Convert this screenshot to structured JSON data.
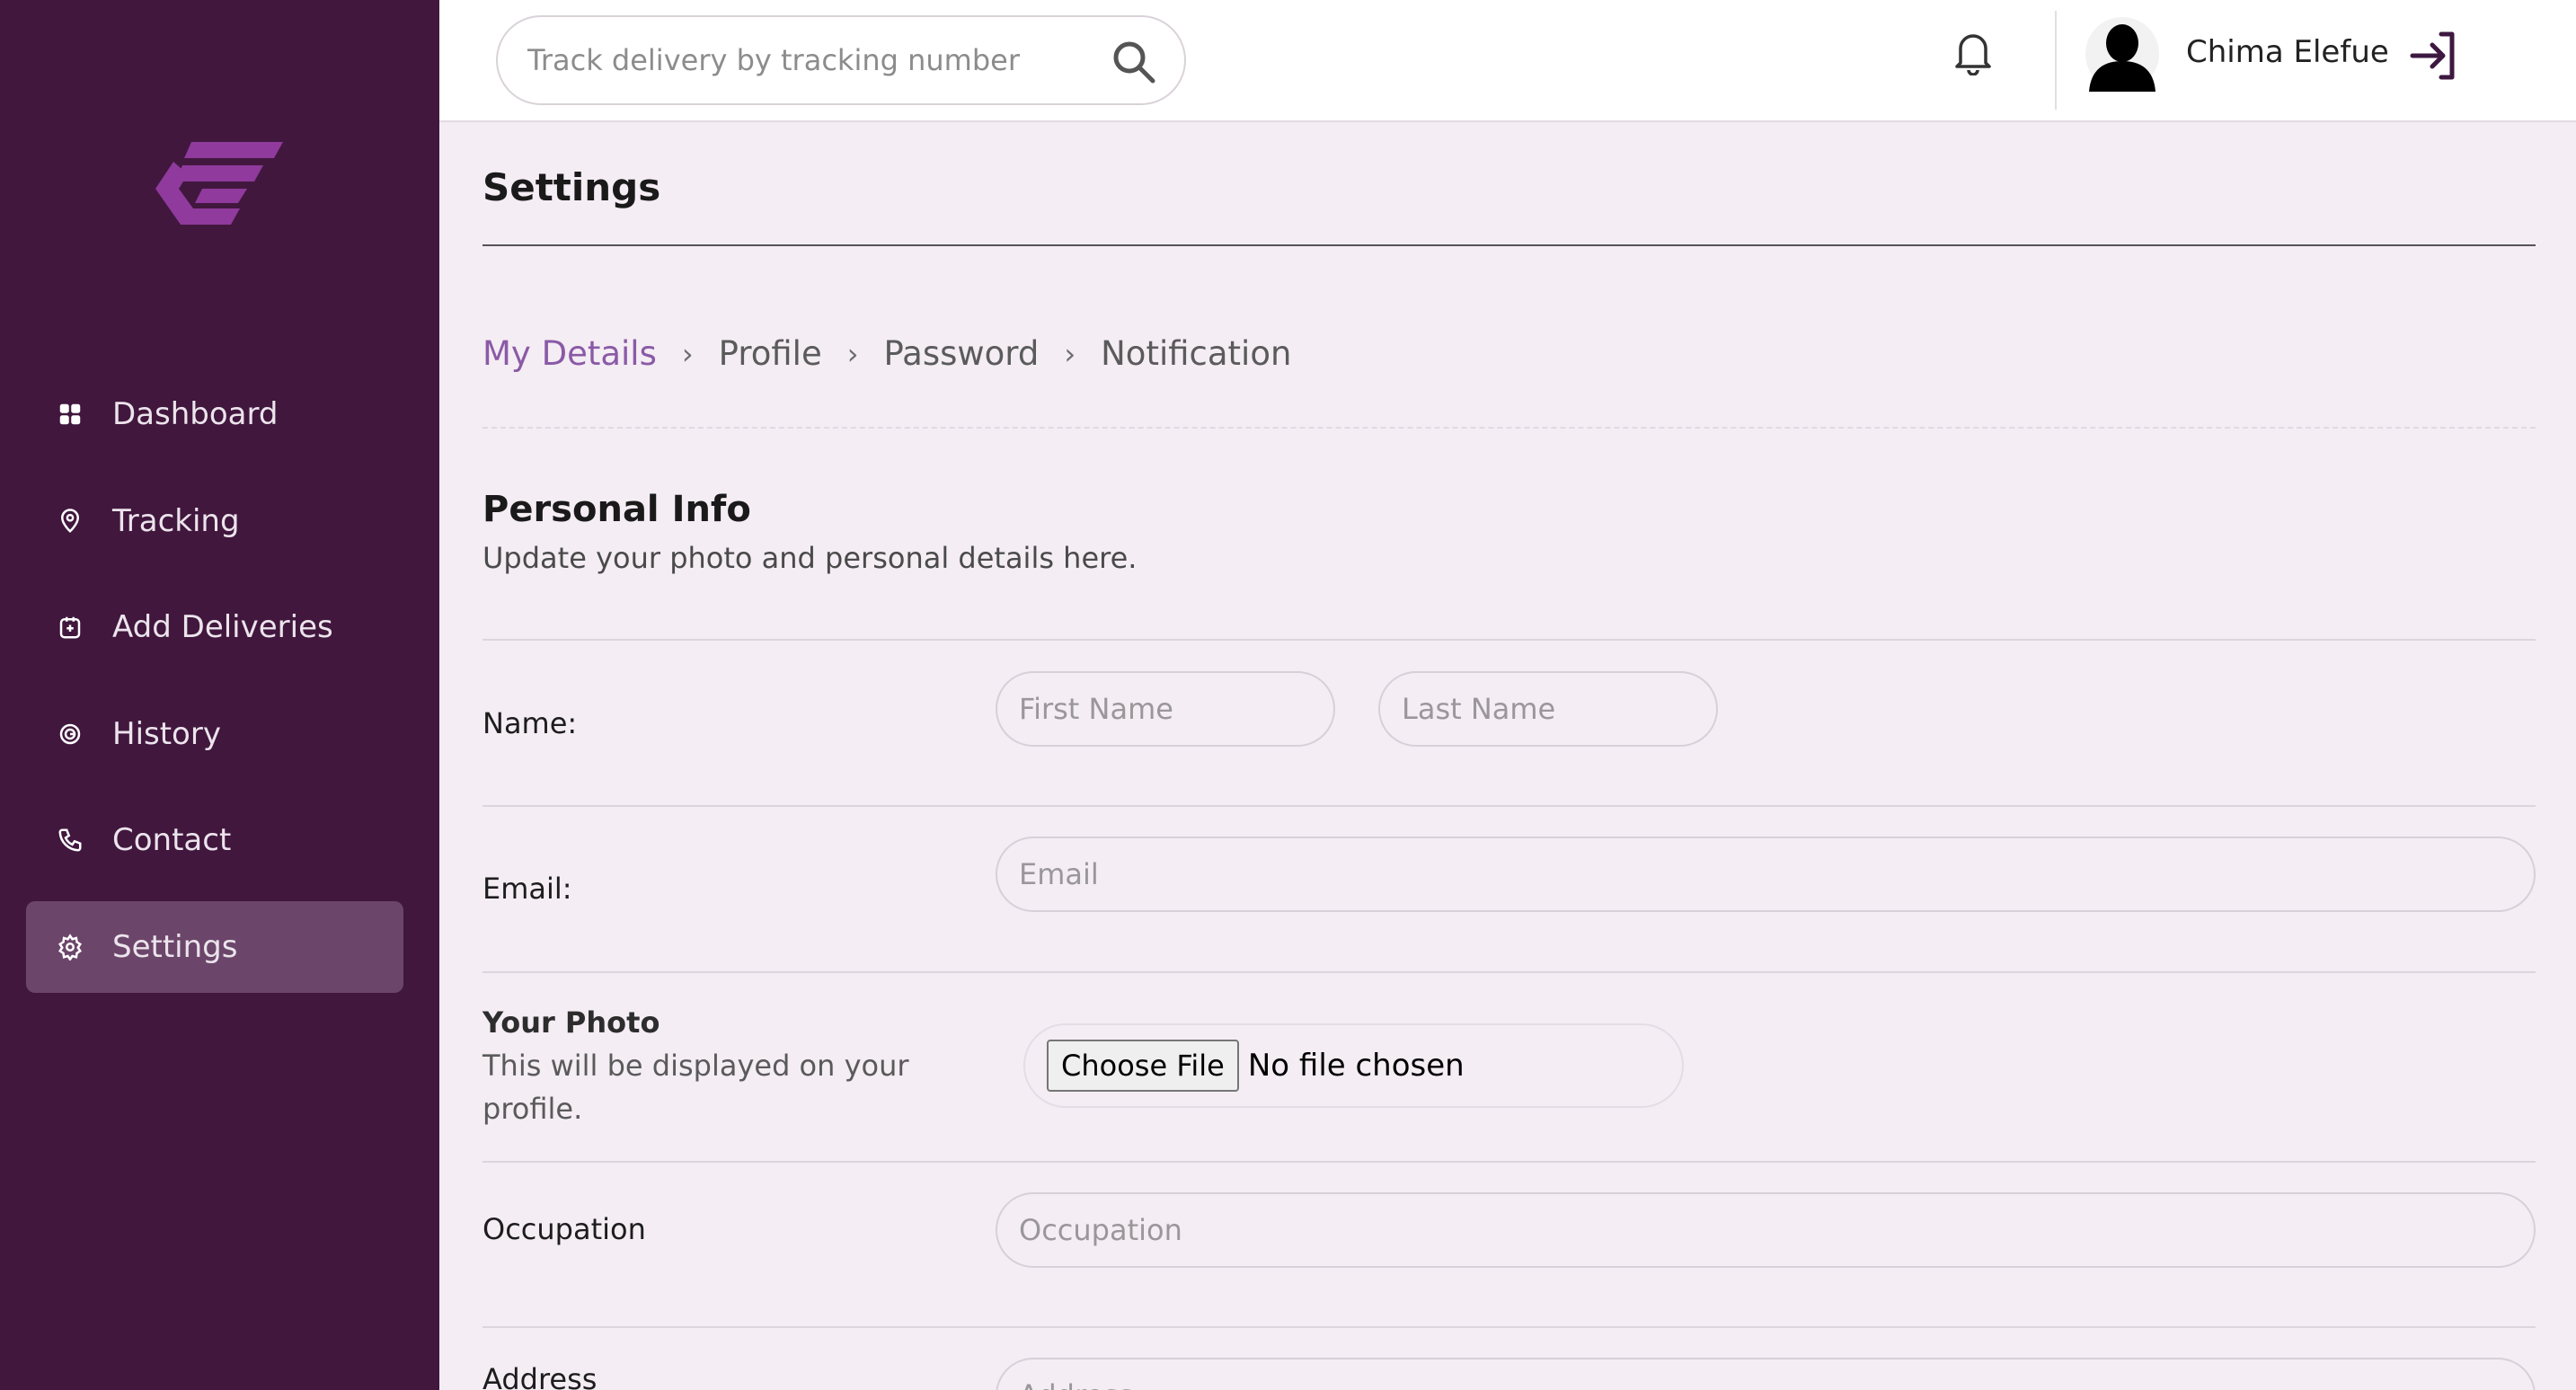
{
  "colors": {
    "sidebar_bg": "#41173e",
    "sidebar_active": "#6b466a",
    "accent": "#8a5aa6",
    "logo": "#8f3a9c",
    "page_bg": "#f4edf4"
  },
  "sidebar": {
    "logo_icon": "brand-logo-icon",
    "items": [
      {
        "label": "Dashboard",
        "icon": "grid-icon"
      },
      {
        "label": "Tracking",
        "icon": "map-pin-icon"
      },
      {
        "label": "Add Deliveries",
        "icon": "package-add-icon"
      },
      {
        "label": "History",
        "icon": "history-icon"
      },
      {
        "label": "Contact",
        "icon": "phone-icon"
      },
      {
        "label": "Settings",
        "icon": "gear-icon",
        "active": true
      }
    ]
  },
  "header": {
    "search_placeholder": "Track delivery by tracking number",
    "user_name": "Chima Elefue"
  },
  "page": {
    "title": "Settings",
    "tabs": [
      "My Details",
      "Profile",
      "Password",
      "Notification"
    ],
    "active_tab": "My Details",
    "section_title": "Personal Info",
    "section_subtitle": "Update your photo and personal details here."
  },
  "form": {
    "name_label": "Name:",
    "first_name_placeholder": "First Name",
    "last_name_placeholder": "Last Name",
    "email_label": "Email:",
    "email_placeholder": "Email",
    "photo_title": "Your Photo",
    "photo_desc": "This will be displayed on your profile.",
    "file_button": "Choose File",
    "file_status": "No file chosen",
    "occupation_label": "Occupation",
    "occupation_placeholder": "Occupation",
    "address_label": "Address",
    "address_placeholder": "Address"
  }
}
